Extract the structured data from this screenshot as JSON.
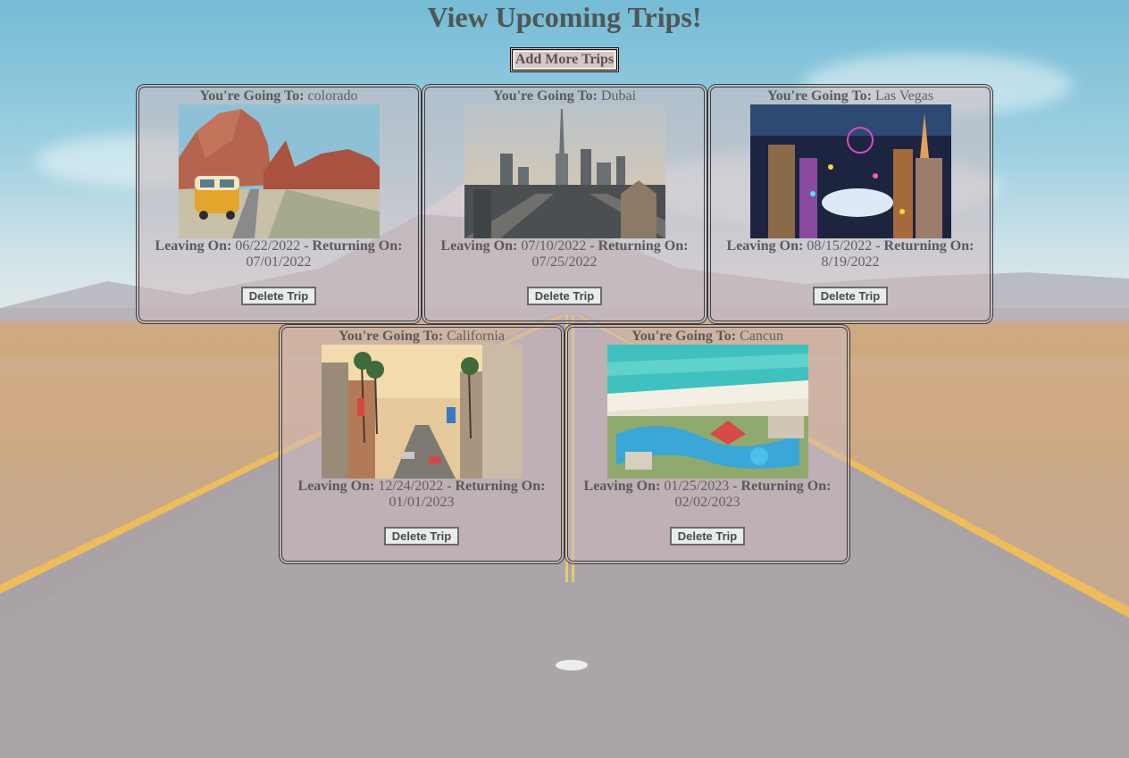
{
  "page": {
    "title": "View Upcoming Trips!",
    "add_button": "Add More Trips"
  },
  "labels": {
    "going_to": "You're Going To:",
    "leaving_on": "Leaving On:",
    "returning_on": "Returning On:",
    "separator": "-",
    "delete_button": "Delete Trip"
  },
  "trips": [
    {
      "destination": "colorado",
      "leaving": "06/22/2022",
      "returning": "07/01/2022",
      "photo": "red-rock-canyon-van-photo"
    },
    {
      "destination": "Dubai",
      "leaving": "07/10/2022",
      "returning": "07/25/2022",
      "photo": "dubai-skyline-photo"
    },
    {
      "destination": "Las Vegas",
      "leaving": "08/15/2022",
      "returning": "8/19/2022",
      "photo": "las-vegas-night-photo"
    },
    {
      "destination": "California",
      "leaving": "12/24/2022",
      "returning": "01/01/2023",
      "photo": "california-street-photo"
    },
    {
      "destination": "Cancun",
      "leaving": "01/25/2023",
      "returning": "02/02/2023",
      "photo": "cancun-resort-photo"
    }
  ],
  "colors": {
    "card_border": "#3d3d3d",
    "card_fill": "#cdb9be",
    "text": "#545454",
    "road_line": "#f2b53a"
  }
}
